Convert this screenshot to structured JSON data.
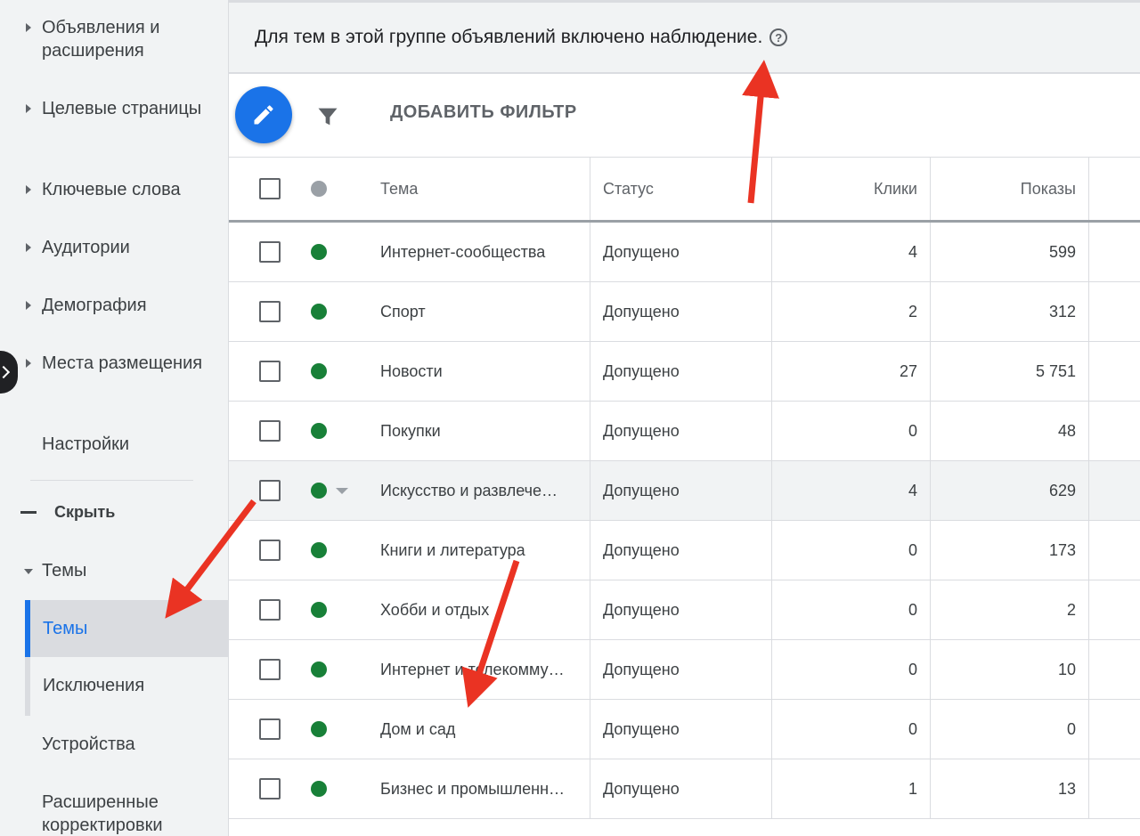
{
  "sidebar": {
    "items": [
      {
        "label": "Объявления и расширения",
        "expandable": true
      },
      {
        "label": "Целевые страницы",
        "expandable": true
      },
      {
        "label": "Ключевые слова",
        "expandable": true
      },
      {
        "label": "Аудитории",
        "expandable": true
      },
      {
        "label": "Демография",
        "expandable": true
      },
      {
        "label": "Места размещения",
        "expandable": true
      },
      {
        "label": "Настройки",
        "expandable": false
      }
    ],
    "hide_label": "Скрыть",
    "themes_section": "Темы",
    "sub_items": [
      {
        "label": "Темы",
        "active": true
      },
      {
        "label": "Исключения",
        "active": false
      }
    ],
    "bottom_items": [
      {
        "label": "Устройства"
      },
      {
        "label": "Расширенные корректировки"
      }
    ]
  },
  "notice": {
    "text": "Для тем в этой группе объявлений включено наблюдение.",
    "help_icon": "help-circle-icon"
  },
  "toolbar": {
    "edit_icon": "pencil-icon",
    "filter_icon": "funnel-icon",
    "add_filter_label": "ДОБАВИТЬ ФИЛЬТР"
  },
  "table": {
    "headers": {
      "theme": "Тема",
      "status": "Статус",
      "clicks": "Клики",
      "impressions": "Показы"
    },
    "rows": [
      {
        "theme": "Интернет-сообщества",
        "status": "Допущено",
        "clicks": "4",
        "impressions": "599"
      },
      {
        "theme": "Спорт",
        "status": "Допущено",
        "clicks": "2",
        "impressions": "312"
      },
      {
        "theme": "Новости",
        "status": "Допущено",
        "clicks": "27",
        "impressions": "5 751"
      },
      {
        "theme": "Покупки",
        "status": "Допущено",
        "clicks": "0",
        "impressions": "48"
      },
      {
        "theme": "Искусство и развлече…",
        "status": "Допущено",
        "clicks": "4",
        "impressions": "629"
      },
      {
        "theme": "Книги и литература",
        "status": "Допущено",
        "clicks": "0",
        "impressions": "173"
      },
      {
        "theme": "Хобби и отдых",
        "status": "Допущено",
        "clicks": "0",
        "impressions": "2"
      },
      {
        "theme": "Интернет и телекомму…",
        "status": "Допущено",
        "clicks": "0",
        "impressions": "10"
      },
      {
        "theme": "Дом и сад",
        "status": "Допущено",
        "clicks": "0",
        "impressions": "0"
      },
      {
        "theme": "Бизнес и промышленн…",
        "status": "Допущено",
        "clicks": "1",
        "impressions": "13"
      }
    ]
  },
  "colors": {
    "accent": "#1a73e8",
    "status_enabled": "#188038",
    "annotation_arrow": "#ea3323"
  }
}
